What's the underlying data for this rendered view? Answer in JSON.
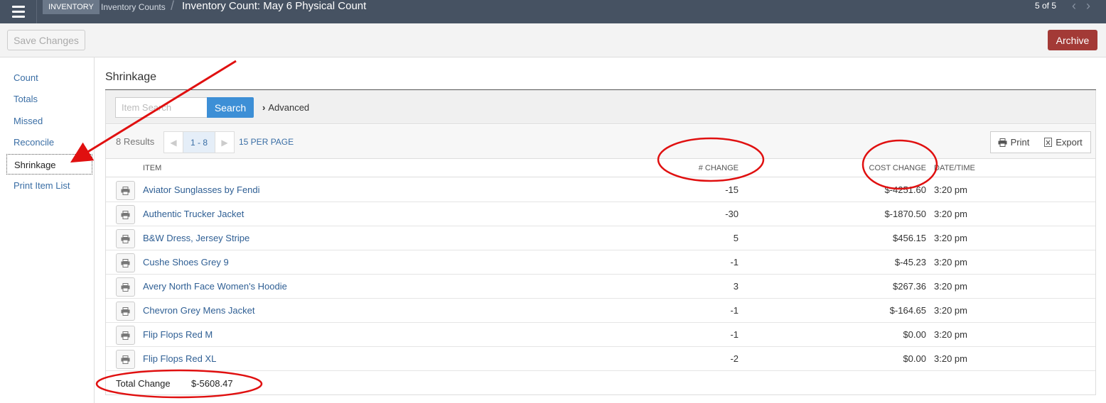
{
  "header": {
    "module": "INVENTORY",
    "breadcrumb": "Inventory Counts",
    "separator": "/",
    "title": "Inventory Count: May 6 Physical Count",
    "record_position": "5 of 5"
  },
  "toolbar": {
    "save_label": "Save Changes",
    "archive_label": "Archive"
  },
  "sidebar": {
    "items": [
      {
        "label": "Count"
      },
      {
        "label": "Totals"
      },
      {
        "label": "Missed"
      },
      {
        "label": "Reconcile"
      },
      {
        "label": "Shrinkage",
        "active": true
      },
      {
        "label": "Print Item List"
      }
    ]
  },
  "main": {
    "section_title": "Shrinkage",
    "search": {
      "placeholder": "Item Search",
      "button_label": "Search",
      "advanced_label": "Advanced"
    },
    "results": {
      "count_label": "8 Results",
      "page_range": "1 - 8",
      "per_page": "15 PER PAGE",
      "print_label": "Print",
      "export_label": "Export"
    },
    "table": {
      "columns": [
        "ITEM",
        "# CHANGE",
        "COST CHANGE",
        "DATE/TIME"
      ],
      "rows": [
        {
          "item": "Aviator Sunglasses by Fendi",
          "change": "-15",
          "cost": "$-4251.60",
          "time": "3:20 pm"
        },
        {
          "item": "Authentic Trucker Jacket",
          "change": "-30",
          "cost": "$-1870.50",
          "time": "3:20 pm"
        },
        {
          "item": "B&W Dress, Jersey Stripe",
          "change": "5",
          "cost": "$456.15",
          "time": "3:20 pm"
        },
        {
          "item": "Cushe Shoes Grey 9",
          "change": "-1",
          "cost": "$-45.23",
          "time": "3:20 pm"
        },
        {
          "item": "Avery North Face Women's Hoodie",
          "change": "3",
          "cost": "$267.36",
          "time": "3:20 pm"
        },
        {
          "item": "Chevron Grey Mens Jacket",
          "change": "-1",
          "cost": "$-164.65",
          "time": "3:20 pm"
        },
        {
          "item": "Flip Flops Red M",
          "change": "-1",
          "cost": "$0.00",
          "time": "3:20 pm"
        },
        {
          "item": "Flip Flops Red XL",
          "change": "-2",
          "cost": "$0.00",
          "time": "3:20 pm"
        }
      ]
    },
    "total": {
      "label": "Total Change",
      "value": "$-5608.47"
    }
  },
  "colors": {
    "topbar": "#465262",
    "link": "#2f5f94",
    "search_button": "#3d8fd6",
    "archive_button": "#a33a36",
    "annotation": "#e01010"
  },
  "icons": {
    "menu": "hamburger-icon",
    "row_print": "printer-icon",
    "export": "spreadsheet-icon"
  }
}
